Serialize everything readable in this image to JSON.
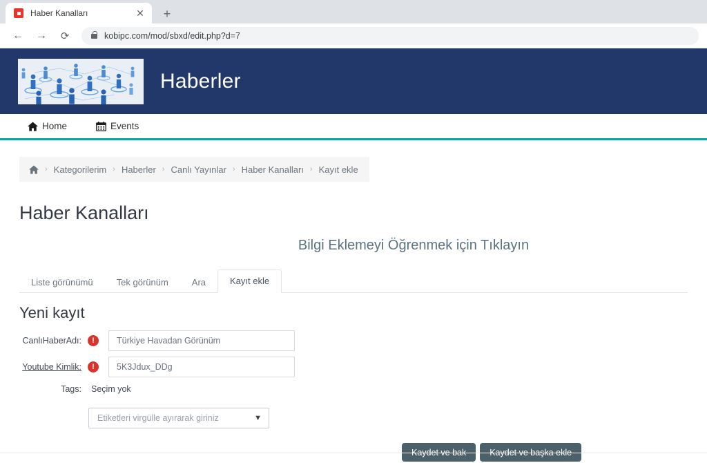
{
  "browser": {
    "tab": {
      "title": "Haber Kanalları",
      "favicon": "red-square-icon",
      "close_label": "✕"
    },
    "new_tab_label": "+",
    "back_label": "←",
    "forward_label": "→",
    "reload_label": "⟳",
    "url": "kobipc.com/mod/sbxd/edit.php?d=7",
    "lock_icon": "lock-icon"
  },
  "site": {
    "title": "Haberler",
    "logo_alt": "people-network-logo",
    "header_color": "#22386b",
    "accent_color": "#00a99d",
    "nav": [
      {
        "label": "Home",
        "icon": "home-icon"
      },
      {
        "label": "Events",
        "icon": "calendar-icon"
      }
    ]
  },
  "breadcrumb": {
    "home_icon": "home-icon",
    "separator": "›",
    "items": [
      {
        "label": "Kategorilerim"
      },
      {
        "label": "Haberler"
      },
      {
        "label": "Canlı Yayınlar"
      },
      {
        "label": "Haber Kanalları"
      },
      {
        "label": "Kayıt ekle"
      }
    ]
  },
  "page": {
    "title": "Haber Kanalları",
    "promo_heading": "Bilgi Eklemeyi Öğrenmek için Tıklayın",
    "promo_color": "#5b7380"
  },
  "tabs": [
    {
      "label": "Liste görünümü",
      "active": false
    },
    {
      "label": "Tek görünüm",
      "active": false
    },
    {
      "label": "Ara",
      "active": false
    },
    {
      "label": "Kayıt ekle",
      "active": true
    }
  ],
  "form": {
    "title": "Yeni kayıt",
    "required_icon": "!",
    "fields": [
      {
        "label": "CanlıHaberAdı:",
        "required": true,
        "value": "Türkiye Havadan Görünüm",
        "placeholder": ""
      },
      {
        "label": "Youtube Kimlik:",
        "required": true,
        "value": "5K3Jdux_DDg",
        "placeholder": ""
      }
    ],
    "tags": {
      "label": "Tags:",
      "value": "Seçim yok",
      "select_placeholder": "Etiketleri virgülle ayırarak giriniz",
      "caret": "▼"
    },
    "buttons": [
      {
        "label": "Kaydet ve bak"
      },
      {
        "label": "Kaydet ve başka ekle"
      }
    ],
    "button_color": "#4c6069"
  }
}
